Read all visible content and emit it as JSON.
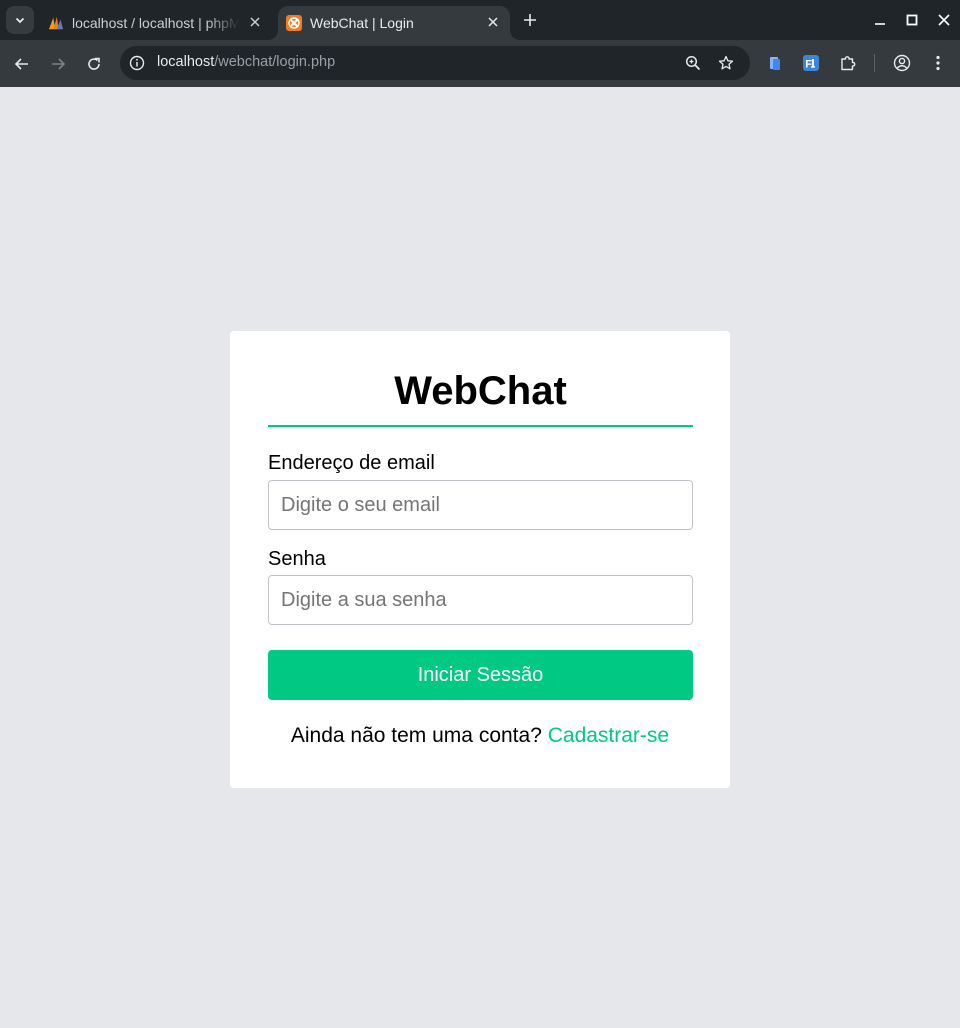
{
  "browser": {
    "tabs": [
      {
        "title": "localhost / localhost | phpMyAdmin",
        "favicon": "phpmyadmin-icon",
        "active": false
      },
      {
        "title": "WebChat | Login",
        "favicon": "xampp-icon",
        "active": true
      }
    ],
    "address": {
      "host": "localhost",
      "path": "/webchat/login.php"
    },
    "colors": {
      "chrome_dark": "#1f2528",
      "chrome_toolbar": "#343a3e"
    }
  },
  "login": {
    "brand": "WebChat",
    "email_label": "Endereço de email",
    "email_placeholder": "Digite o seu email",
    "password_label": "Senha",
    "password_placeholder": "Digite a sua senha",
    "submit_label": "Iniciar Sessão",
    "signup_prompt": "Ainda não tem uma conta?",
    "signup_link": "Cadastrar-se"
  },
  "colors": {
    "accent": "#00c983",
    "background": "#e5e7eb",
    "card": "#ffffff"
  }
}
